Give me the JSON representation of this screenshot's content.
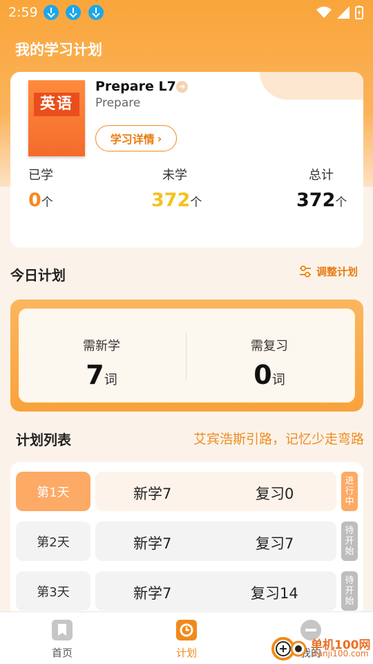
{
  "status_bar": {
    "time": "2:59"
  },
  "page_title": "我的学习计划",
  "book": {
    "cover_word": "英语",
    "title": "Prepare L7",
    "subtitle": "Prepare",
    "detail_button": "学习详情"
  },
  "stats": [
    {
      "label": "已学",
      "value": "0",
      "unit": "个",
      "color": "#f7891f"
    },
    {
      "label": "未学",
      "value": "372",
      "unit": "个",
      "color": "#f5c21d"
    },
    {
      "label": "总计",
      "value": "372",
      "unit": "个",
      "color": "#111111"
    }
  ],
  "today": {
    "title": "今日计划",
    "adjust_label": "调整计划",
    "new_label": "需新学",
    "new_value": "7",
    "review_label": "需复习",
    "review_value": "0",
    "unit": "词"
  },
  "plan_list": {
    "title": "计划列表",
    "slogan": "艾宾浩斯引路，记忆少走弯路",
    "rows": [
      {
        "day": "第1天",
        "new": "新学7",
        "review": "复习0",
        "status": "进行中",
        "active": true
      },
      {
        "day": "第2天",
        "new": "新学7",
        "review": "复习7",
        "status": "待开始",
        "active": false
      },
      {
        "day": "第3天",
        "new": "新学7",
        "review": "复习14",
        "status": "待开始",
        "active": false
      }
    ]
  },
  "nav": [
    {
      "label": "首页",
      "icon": "bookmark-icon",
      "active": false
    },
    {
      "label": "计划",
      "icon": "clock-icon",
      "active": true
    },
    {
      "label": "我的",
      "icon": "profile-icon",
      "active": false
    }
  ],
  "watermark": {
    "text": "单机100网",
    "url": "danji100.com"
  },
  "colors": {
    "accent": "#f9a53a",
    "active_tab": "#f08a1a",
    "slogan": "#ef8c22"
  }
}
